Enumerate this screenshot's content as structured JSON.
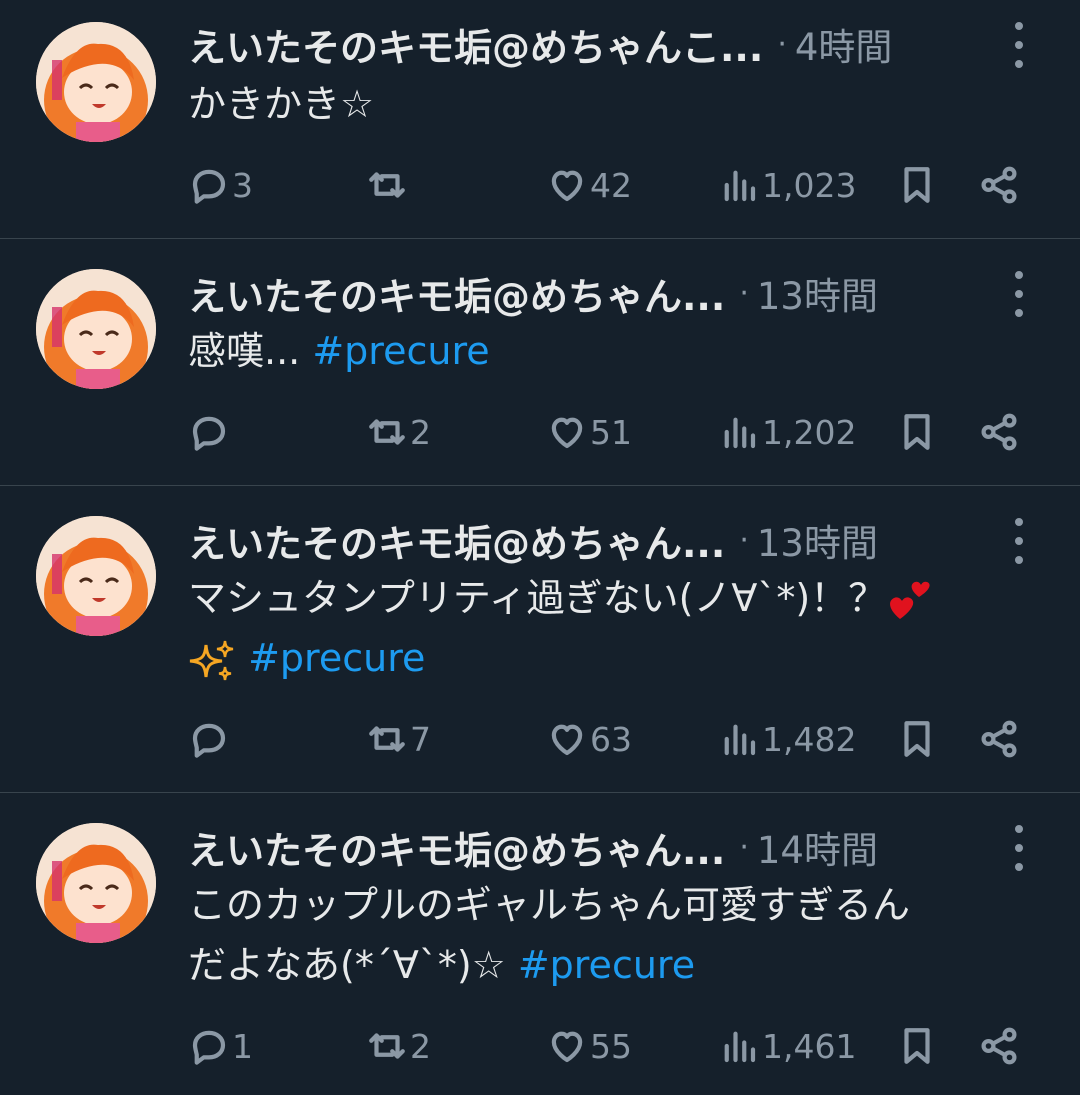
{
  "colors": {
    "background": "#15202b",
    "text": "#e7e9ea",
    "secondary": "#8b98a5",
    "hashtag": "#1d9bf0",
    "divider": "#38444d"
  },
  "tweets": [
    {
      "name": "えいたそのキモ垢@めちゃんこ...",
      "time": "4時間",
      "text": "かきかき☆",
      "hashtag": "",
      "body2": "",
      "emoji_after": "",
      "replies": "3",
      "retweets": "",
      "likes": "42",
      "views": "1,023"
    },
    {
      "name": "えいたそのキモ垢@めちゃん...",
      "time": "13時間",
      "text": "感嘆...",
      "hashtag": "#precure",
      "replies": "",
      "retweets": "2",
      "likes": "51",
      "views": "1,202"
    },
    {
      "name": "えいたそのキモ垢@めちゃん...",
      "time": "13時間",
      "text": "マシュタンプリティ過ぎない(ノ∀`*)！？",
      "hashtag": "#precure",
      "replies": "",
      "retweets": "7",
      "likes": "63",
      "views": "1,482"
    },
    {
      "name": "えいたそのキモ垢@めちゃん...",
      "time": "14時間",
      "text": "このカップルのギャルちゃん可愛すぎるん",
      "text_line2": "だよなあ(*´∀`*)☆",
      "hashtag": "#precure",
      "replies": "1",
      "retweets": "2",
      "likes": "55",
      "views": "1,461"
    }
  ],
  "icons": {
    "reply": "reply-icon",
    "retweet": "retweet-icon",
    "like": "heart-icon",
    "views": "views-icon",
    "bookmark": "bookmark-icon",
    "share": "share-icon",
    "more": "more-icon"
  }
}
